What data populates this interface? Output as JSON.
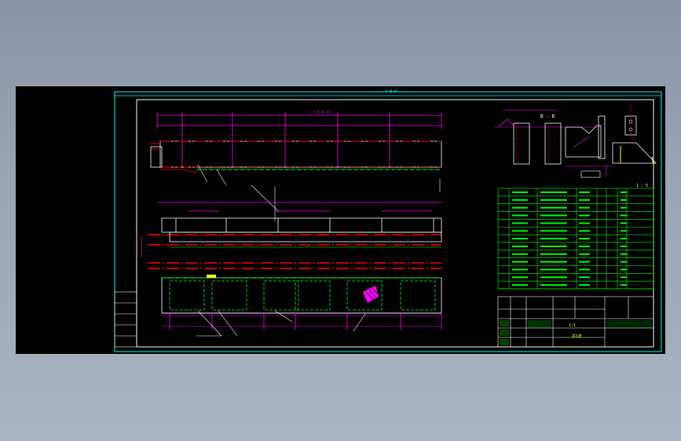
{
  "viewer": {
    "background": "#000000",
    "frame_color": "#00ffff",
    "dimension_color": "#ff00ff",
    "centerline_color": "#ff0000",
    "body_color": "#ffffff",
    "table_color": "#00ff00",
    "accent_color": "#ffff00"
  },
  "drawing": {
    "overall_dim_top": "4 9 0",
    "main_length_dim": "1 0 0 0",
    "section_label": "B - B",
    "scale_label": "1 : 5"
  },
  "title_block": {
    "scale": "1:1",
    "sheet": "共1张"
  }
}
